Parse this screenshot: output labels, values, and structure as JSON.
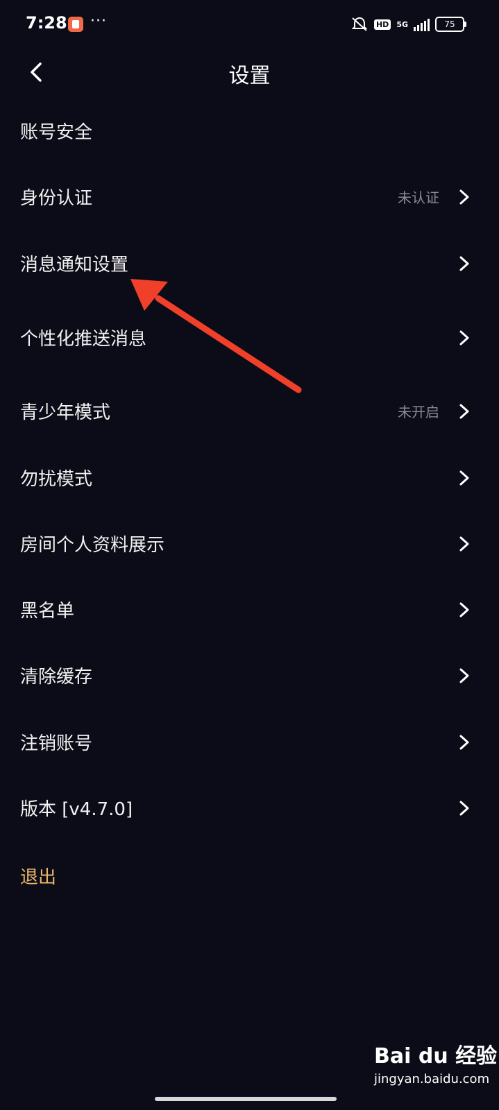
{
  "status_bar": {
    "time": "7:28",
    "more": "···",
    "hd": "HD",
    "network": "5G",
    "battery": "75"
  },
  "header": {
    "title": "设置"
  },
  "menu": [
    {
      "label": "账号安全",
      "status": "",
      "chevron": false
    },
    {
      "label": "身份认证",
      "status": "未认证",
      "chevron": true
    },
    {
      "label": "消息通知设置",
      "status": "",
      "chevron": true
    },
    {
      "label": "个性化推送消息",
      "status": "",
      "chevron": true
    },
    {
      "label": "青少年模式",
      "status": "未开启",
      "chevron": true
    },
    {
      "label": "勿扰模式",
      "status": "",
      "chevron": true
    },
    {
      "label": "房间个人资料展示",
      "status": "",
      "chevron": true
    },
    {
      "label": "黑名单",
      "status": "",
      "chevron": true
    },
    {
      "label": "清除缓存",
      "status": "",
      "chevron": true
    },
    {
      "label": "注销账号",
      "status": "",
      "chevron": true
    },
    {
      "label": "版本 [v4.7.0]",
      "status": "",
      "chevron": true
    }
  ],
  "logout": "退出",
  "watermark": {
    "main": "Bai du 经验",
    "sub": "jingyan.baidu.com"
  },
  "colors": {
    "background": "#0c0c18",
    "logout": "#e9b66a",
    "annotation_arrow": "#f0402a"
  }
}
